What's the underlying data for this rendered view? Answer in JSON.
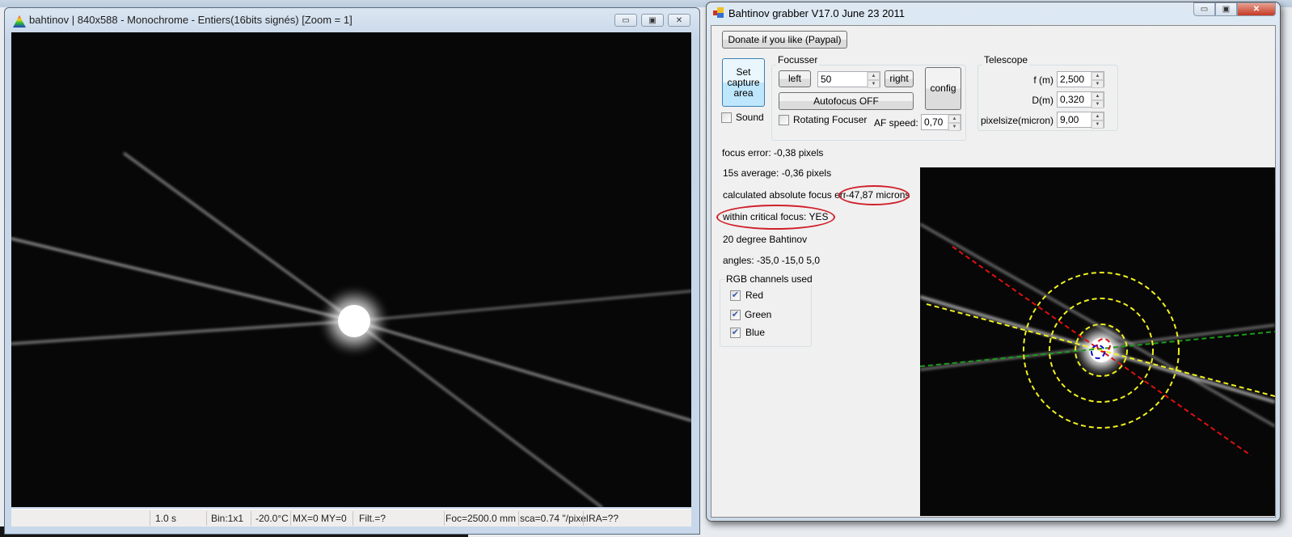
{
  "viewer": {
    "title": "bahtinov | 840x588 - Monochrome - Entiers(16bits signés)   [Zoom = 1]",
    "status": [
      "1.0 s",
      "Bin:1x1",
      "-20.0°C",
      "MX=0 MY=0",
      "Filt.=?",
      "Foc=2500.0 mm",
      "sca=0.74 \"/pixel",
      "RA=??"
    ]
  },
  "grabber": {
    "title": "Bahtinov grabber  V17.0 June 23 2011",
    "donate": "Donate if you like (Paypal)",
    "set_capture": "Set capture area",
    "sound": {
      "label": "Sound",
      "checked": false
    },
    "focusser": {
      "title": "Focusser",
      "left": "left",
      "right": "right",
      "step": "50",
      "config": "config",
      "autofocus": "Autofocus OFF",
      "rotating": {
        "label": "Rotating Focuser",
        "checked": false
      },
      "af_speed_label": "AF speed:",
      "af_speed": "0,70"
    },
    "telescope": {
      "title": "Telescope",
      "f_label": "f (m)",
      "f": "2,500",
      "d_label": "D(m)",
      "d": "0,320",
      "px_label": "pixelsize(micron)",
      "px": "9,00"
    },
    "results": {
      "focus_error": "focus error: -0,38 pixels",
      "avg": "15s average: -0,36 pixels",
      "abs_label": "calculated absolute focus error:",
      "abs_value": "-47,87 microns",
      "critical": "within critical focus: YES",
      "bahtinov": "20 degree Bahtinov",
      "angles": "angles: -35,0 -15,0 5,0"
    },
    "rgb": {
      "title": "RGB channels used",
      "channels": [
        {
          "label": "Red",
          "checked": true
        },
        {
          "label": "Green",
          "checked": true
        },
        {
          "label": "Blue",
          "checked": true
        }
      ]
    },
    "overlay_colors": {
      "red": "#e01010",
      "yellow": "#f0f020",
      "green": "#1a9a1a",
      "blue": "#1010d0"
    }
  }
}
